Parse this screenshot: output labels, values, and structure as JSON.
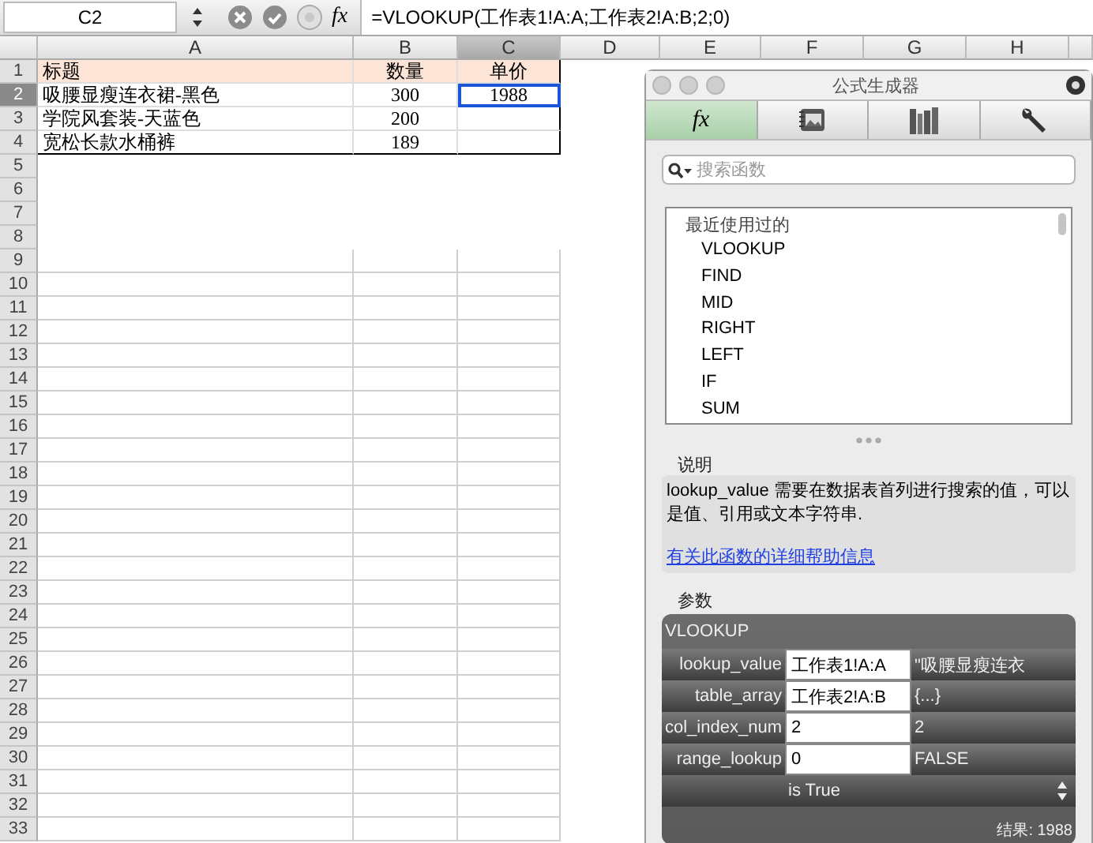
{
  "formula_bar": {
    "cell_ref": "C2",
    "fx": "fx",
    "formula": "=VLOOKUP(工作表1!A:A;工作表2!A:B;2;0)"
  },
  "columns": [
    {
      "label": "A",
      "selected": false
    },
    {
      "label": "B",
      "selected": false
    },
    {
      "label": "C",
      "selected": true
    },
    {
      "label": "D",
      "selected": false
    },
    {
      "label": "E",
      "selected": false
    },
    {
      "label": "F",
      "selected": false
    },
    {
      "label": "G",
      "selected": false
    },
    {
      "label": "H",
      "selected": false
    }
  ],
  "rows": [
    {
      "number": "1",
      "selected": false,
      "kind": "header",
      "cells": [
        {
          "text": "标题",
          "selected": false
        },
        {
          "text": "数量",
          "selected": false
        },
        {
          "text": "单价",
          "selected": false
        }
      ]
    },
    {
      "number": "2",
      "selected": true,
      "kind": "data",
      "cells": [
        {
          "text": "吸腰显瘦连衣裙-黑色",
          "selected": false
        },
        {
          "text": "300",
          "selected": false
        },
        {
          "text": "1988",
          "selected": true
        }
      ]
    },
    {
      "number": "3",
      "selected": false,
      "kind": "data",
      "cells": [
        {
          "text": "学院风套装-天蓝色",
          "selected": false
        },
        {
          "text": "200",
          "selected": false
        },
        {
          "selected": false
        }
      ]
    },
    {
      "number": "4",
      "selected": false,
      "kind": "data",
      "cells": [
        {
          "text": "宽松长款水桶裤",
          "selected": false
        },
        {
          "text": "189",
          "selected": false
        },
        {
          "selected": false
        }
      ]
    },
    {
      "number": "5",
      "selected": false,
      "kind": "empty"
    },
    {
      "number": "6",
      "selected": false,
      "kind": "empty"
    },
    {
      "number": "7",
      "selected": false,
      "kind": "empty"
    },
    {
      "number": "8",
      "selected": false,
      "kind": "empty"
    },
    {
      "number": "9",
      "selected": false,
      "kind": "grid"
    },
    {
      "number": "10",
      "selected": false,
      "kind": "grid"
    },
    {
      "number": "11",
      "selected": false,
      "kind": "grid"
    },
    {
      "number": "12",
      "selected": false,
      "kind": "grid"
    },
    {
      "number": "13",
      "selected": false,
      "kind": "grid"
    },
    {
      "number": "14",
      "selected": false,
      "kind": "grid"
    },
    {
      "number": "15",
      "selected": false,
      "kind": "grid"
    },
    {
      "number": "16",
      "selected": false,
      "kind": "grid"
    },
    {
      "number": "17",
      "selected": false,
      "kind": "grid"
    },
    {
      "number": "18",
      "selected": false,
      "kind": "grid"
    },
    {
      "number": "19",
      "selected": false,
      "kind": "grid"
    },
    {
      "number": "20",
      "selected": false,
      "kind": "grid"
    },
    {
      "number": "21",
      "selected": false,
      "kind": "grid"
    },
    {
      "number": "22",
      "selected": false,
      "kind": "grid"
    },
    {
      "number": "23",
      "selected": false,
      "kind": "grid"
    },
    {
      "number": "24",
      "selected": false,
      "kind": "grid"
    },
    {
      "number": "25",
      "selected": false,
      "kind": "grid"
    },
    {
      "number": "26",
      "selected": false,
      "kind": "grid"
    },
    {
      "number": "27",
      "selected": false,
      "kind": "grid"
    },
    {
      "number": "28",
      "selected": false,
      "kind": "grid"
    },
    {
      "number": "29",
      "selected": false,
      "kind": "grid"
    },
    {
      "number": "30",
      "selected": false,
      "kind": "grid"
    },
    {
      "number": "31",
      "selected": false,
      "kind": "grid"
    },
    {
      "number": "32",
      "selected": false,
      "kind": "grid"
    },
    {
      "number": "33",
      "selected": false,
      "kind": "grid"
    }
  ],
  "formula_builder": {
    "title": "公式生成器",
    "tabs": [
      {
        "kind": "fx",
        "label": "fx",
        "selected": true
      },
      {
        "kind": "gallery",
        "selected": false
      },
      {
        "kind": "books",
        "selected": false
      },
      {
        "kind": "wrench",
        "selected": false
      }
    ],
    "search": {
      "placeholder": "搜索函数"
    },
    "function_list": {
      "heading": "最近使用过的",
      "items": [
        "VLOOKUP",
        "FIND",
        "MID",
        "RIGHT",
        "LEFT",
        "IF",
        "SUM"
      ]
    },
    "description": {
      "label": "说明",
      "text": "lookup_value 需要在数据表首列进行搜索的值，可以是值、引用或文本字符串.",
      "link": "有关此函数的详细帮助信息"
    },
    "arguments": {
      "label": "参数",
      "function": "VLOOKUP",
      "rows": [
        {
          "name": "lookup_value",
          "value": "工作表1!A:A",
          "result": "\"吸腰显瘦连衣"
        },
        {
          "name": "table_array",
          "value": "工作表2!A:B",
          "result": "{...}"
        },
        {
          "name": "col_index_num",
          "value": "2",
          "result": "2"
        },
        {
          "name": "range_lookup",
          "value": "0",
          "result": "FALSE"
        }
      ],
      "hint": "is True",
      "result": "结果: 1988"
    }
  }
}
